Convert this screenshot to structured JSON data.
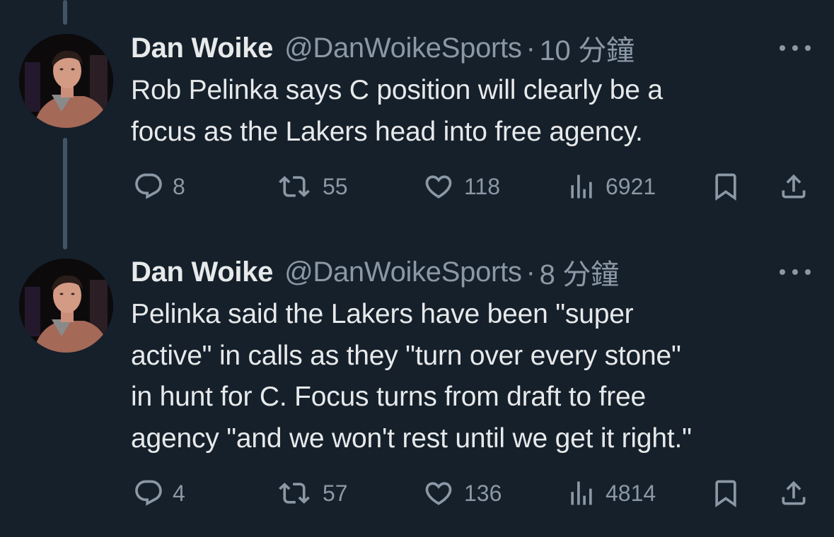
{
  "tweets": [
    {
      "name": "Dan Woike",
      "handle": "@DanWoikeSports",
      "separator": "·",
      "time": "10 分鐘",
      "lines": [
        "Rob Pelinka says C position will clearly be a",
        "focus as the Lakers head into free agency."
      ],
      "replies": "8",
      "retweets": "55",
      "likes": "118",
      "views": "6921"
    },
    {
      "name": "Dan Woike",
      "handle": "@DanWoikeSports",
      "separator": "·",
      "time": "8 分鐘",
      "lines": [
        "Pelinka said the Lakers have been \"super",
        "active\" in calls as they \"turn over every stone\"",
        "in hunt for C. Focus turns from draft to free",
        "agency \"and we won't rest until we get it right.\""
      ],
      "replies": "4",
      "retweets": "57",
      "likes": "136",
      "views": "4814"
    }
  ],
  "icons": {
    "reply": "reply-icon",
    "retweet": "retweet-icon",
    "like": "like-icon",
    "views": "views-icon",
    "bookmark": "bookmark-icon",
    "share": "share-icon",
    "more": "more-icon"
  },
  "colors": {
    "background": "#15202b",
    "text_primary": "#e7e9ea",
    "text_secondary": "#8b98a5",
    "thread_line": "#425566"
  }
}
